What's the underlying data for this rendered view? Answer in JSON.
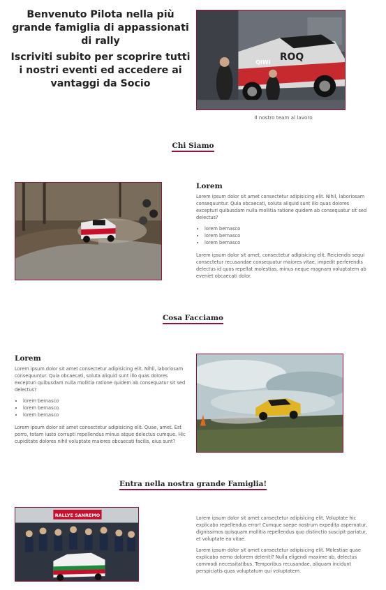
{
  "hero": {
    "title_line1": "Benvenuto Pilota nella più grande famiglia di appassionati di rally",
    "title_line2": "Iscriviti subito per scoprire tutti i nostri eventi ed accedere ai vantaggi da Socio",
    "image_caption": "Il nostro team al lavoro"
  },
  "sections": {
    "chi_siamo": {
      "title": "Chi Siamo",
      "heading": "Lorem",
      "p1": "Lorem ipsum dolor sit amet consectetur adipisicing elit. Nihil, laboriosam consequuntur. Quia obcaecati, soluta aliquid sunt illo quas dolores excepturi quibusdam nulla mollitia ratione quidem ab consequatur sit sed delectus?",
      "list": [
        "lorem bernasco",
        "lorem bernasco",
        "lorem bernasco"
      ],
      "p2": "Lorem ipsum dolor sit amet, consectetur adipisicing elit. Reiciendis sequi consectetur recusandae consequatur maiores vitae, impedit perferendis delectus id quos repellat molestias, minus neque magnam voluptatem ab eveniet obcaecati dolor."
    },
    "cosa_facciamo": {
      "title": "Cosa Facciamo",
      "heading": "Lorem",
      "p1": "Lorem ipsum dolor sit amet consectetur adipisicing elit. Nihil, laboriosam consequuntur. Quia obcaecati, soluta aliquid sunt illo quas dolores excepturi quibusdam nulla mollitia ratione quidem ab consequatur sit sed delectus?",
      "list": [
        "lorem bernasco",
        "lorem bernasco",
        "lorem bernasco"
      ],
      "p2": "Lorem ipsum dolor sit amet consectetur adipisicing elit. Quae, amet. Est porro, totam iusto corrupti repellendus minus atque delectus cumque. Hic cupiditate dolores nihil voluptate maiores obcaecati facilis, eius sunt?"
    },
    "famiglia": {
      "title": "Entra nella nostra grande Famiglia!",
      "p1": "Lorem ipsum dolor sit amet consectetur adipisicing elit. Voluptate hic explicabo repellendus error! Cumque saepe nostrum expedita aspernatur, dignissimos quisquam mollitia repellendus quo distinctio suscipit pariatur, et voluptate ea vitae.",
      "p2": "Lorem ipsum dolor sit amet consectetur adipisicing elit. Molestiae quae explicabo nemo dolorem deleniti? Nulla eligendi maxime ab, delectus commodi necessitatibus. Temporibus recusandae, aliquam incidunt perspiciatis quas voluptatum qui voluptatem."
    }
  },
  "images": {
    "team_photo": {
      "text_1": "ROQ",
      "text_2": "QIWI"
    },
    "team_banner": "RALLYE SANREMO"
  },
  "colors": {
    "accent": "#8a1538"
  }
}
